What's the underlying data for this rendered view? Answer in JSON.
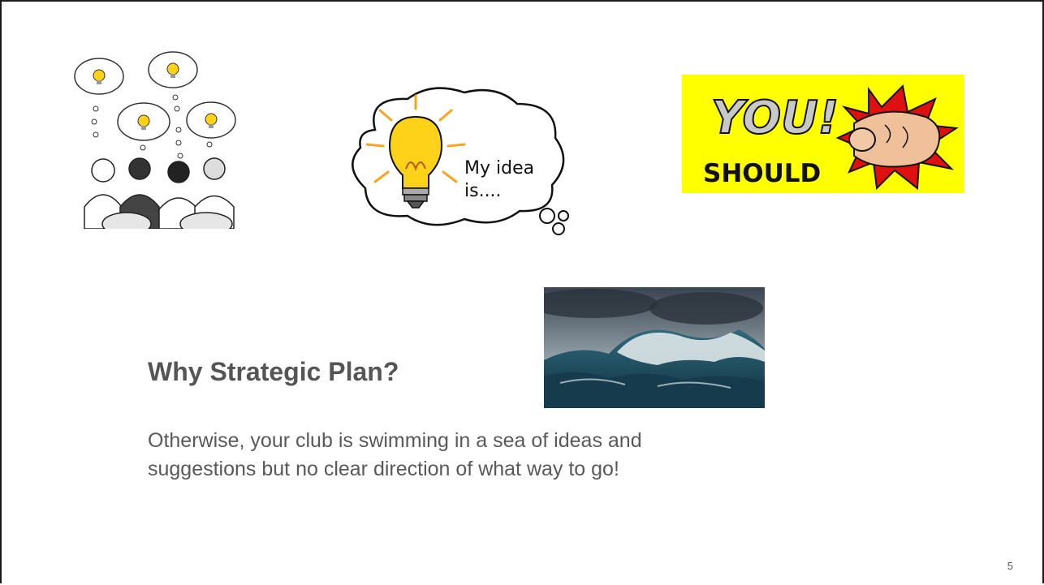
{
  "slide": {
    "title": "Why Strategic Plan?",
    "body_lines": [
      "Otherwise, your club is swimming in a sea of ideas and",
      "suggestions but no clear direction of what way to go!"
    ],
    "page_number": "5"
  },
  "images": {
    "idea_bubble": {
      "line1": "My idea",
      "line2": "is...."
    },
    "you_should": {
      "you": "YOU!",
      "should": "SHOULD",
      "background": "#ffff00"
    }
  },
  "colors": {
    "title": "#555555",
    "body": "#595959",
    "bulb": "#ffd21a",
    "sea": "#1d4e63"
  }
}
